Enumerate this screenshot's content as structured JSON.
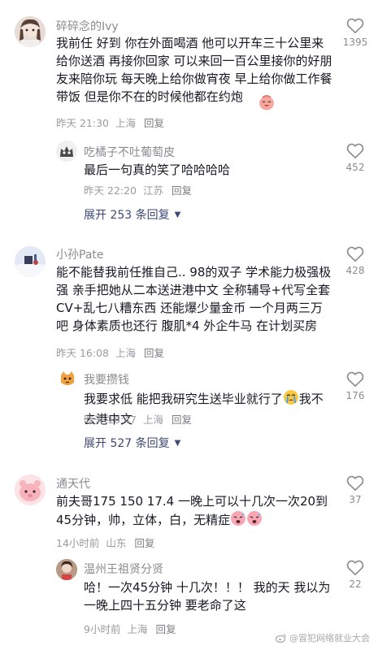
{
  "comments": [
    {
      "username": "碎碎念的Ivy",
      "text": "我前任 好到 你在外面喝酒 他可以开车三十公里来给你送酒 再接你回家 可以来回一百公里接你的好朋友来陪你玩 每天晚上给你做宵夜 早上给你做工作餐带饭 但是你不在的时候他都在约炮",
      "time": "昨天 21:30",
      "location": "上海",
      "reply_label": "回复",
      "likes": "1395",
      "reply": {
        "username": "吃橘子不吐葡萄皮",
        "text": "最后一句真的笑了哈哈哈哈",
        "time": "昨天 22:20",
        "location": "江苏",
        "reply_label": "回复",
        "likes": "452"
      },
      "expand": "展开 253 条回复"
    },
    {
      "username": "小孙Pate",
      "text": "能不能替我前任推自己.. 98的双子 学术能力极强极强 亲手把她从二本送进港中文 全称辅导+代写全套CV+乱七八糟东西 还能爆少量金币 一个月两三万吧 身体素质也还行 腹肌*4 外企牛马 在计划买房",
      "time": "昨天 16:08",
      "location": "上海",
      "reply_label": "回复",
      "likes": "428",
      "reply": {
        "username": "我要攒钱",
        "text_before": "我要求低 能把我研究生送毕业就行了",
        "text_after": "我不去港中文",
        "time": "昨天 16:47",
        "location": "上海",
        "reply_label": "回复",
        "likes": "176"
      },
      "expand": "展开 527 条回复"
    },
    {
      "username": "通天代",
      "text": "前夫哥175 150 17.4 一晚上可以十几次一次20到45分钟，帅，立体，白，无精症",
      "time": "14小时前",
      "location": "山东",
      "reply_label": "回复",
      "likes": "37",
      "reply": {
        "username": "温州王祖贤分贤",
        "text": "哈！一次45分钟 十几次！！！ 我的天 我以为一晚上四十五分钟 要老命了这",
        "time": "9小时前",
        "location": "上海",
        "reply_label": "回复",
        "likes": "22"
      }
    }
  ],
  "watermark": "@冒犯网络就业大会",
  "colors": {
    "username": "#8a8b91",
    "text": "#161823",
    "meta": "#9a9ba1",
    "expand": "#3d4a75"
  }
}
